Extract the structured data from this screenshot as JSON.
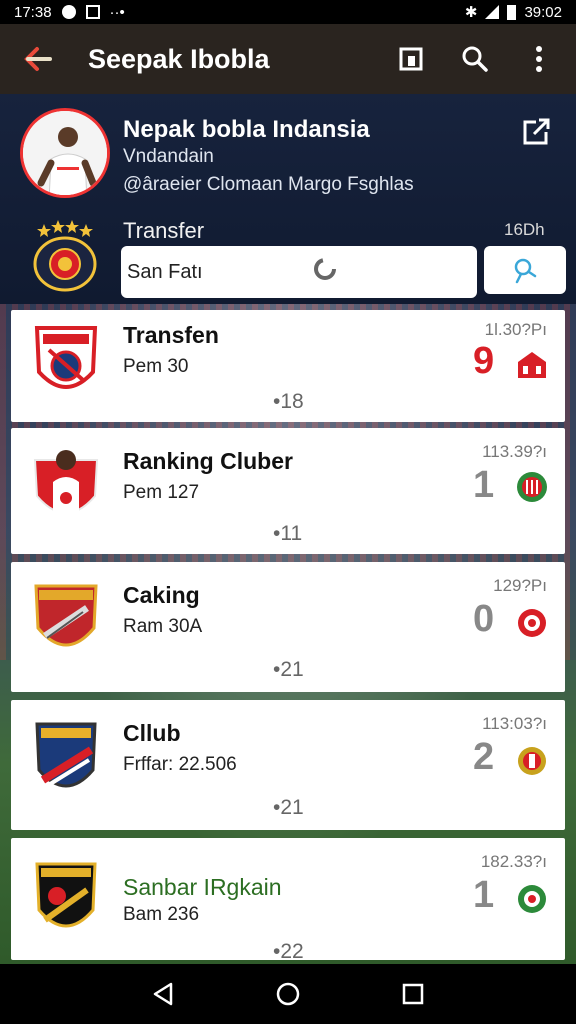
{
  "status_bar": {
    "time_left": "17:38",
    "time_right": "39:02"
  },
  "app_bar": {
    "title": "Seepak Ibobla"
  },
  "profile": {
    "name": "Nepak bobla Indansia",
    "subtitle": "Vndandain",
    "handle": "@âraeier Clomaan Margo Fsghlas",
    "transfer_label": "Transfer",
    "transfer_time": "16Dh",
    "search_value": "San Fatı"
  },
  "list": [
    {
      "title": "Transfen",
      "subtitle": "Pem 30",
      "count": "•18",
      "time": "1l.30?Pı",
      "score": "9",
      "score_color": "#d81f26",
      "badge_color": "#d81f26",
      "title_color": "#111111"
    },
    {
      "title": "Ranking Cluber",
      "subtitle": "Pem 127",
      "count": "•11",
      "time": "113.39?ı",
      "score": "1",
      "score_color": "#888888",
      "badge_color": "#d81f26",
      "title_color": "#111111"
    },
    {
      "title": "Caking",
      "subtitle": "Ram 30A",
      "count": "•21",
      "time": "129?Pı",
      "score": "0",
      "score_color": "#888888",
      "badge_color": "#d81f26",
      "title_color": "#111111"
    },
    {
      "title": "Cllub",
      "subtitle": "Frffar: 22.506",
      "count": "•21",
      "time": "113:03?ı",
      "score": "2",
      "score_color": "#888888",
      "badge_color": "#c8a21d",
      "title_color": "#111111"
    },
    {
      "title": "Sanbar IRgkain",
      "subtitle": "Bam 236",
      "count": "•22",
      "time": "182.33?ı",
      "score": "1",
      "score_color": "#888888",
      "badge_color": "#2c8a3a",
      "title_color": "#2c6e22"
    }
  ]
}
